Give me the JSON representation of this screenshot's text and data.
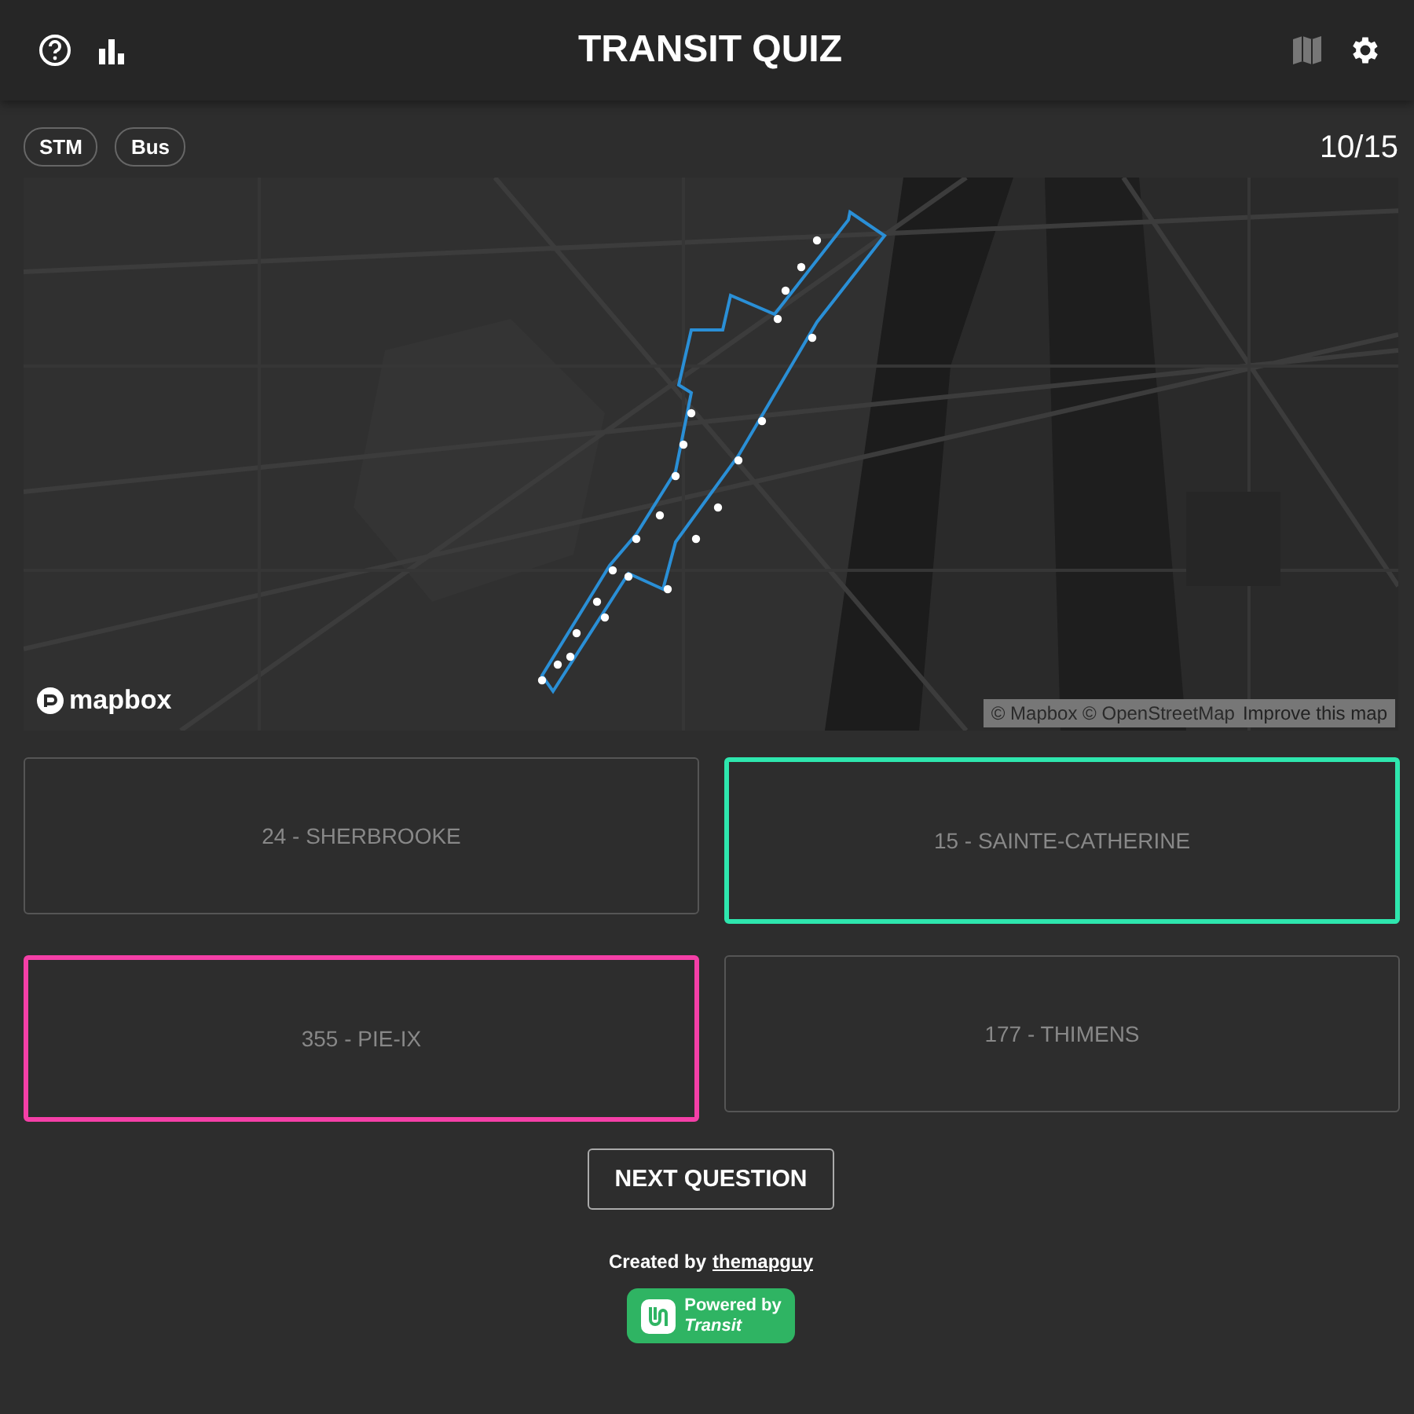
{
  "header": {
    "title": "TRANSIT QUIZ"
  },
  "tags": [
    "STM",
    "Bus"
  ],
  "progress": "10/15",
  "map": {
    "kind": "picture",
    "logo": "mapbox",
    "attribution": "© Mapbox © OpenStreetMap",
    "improve_link": "Improve this map"
  },
  "answers": [
    {
      "label": "24 - SHERBROOKE",
      "selected": false,
      "correct": false
    },
    {
      "label": "15 - SAINTE-CATHERINE",
      "selected": false,
      "correct": true
    },
    {
      "label": "355 - PIE-IX",
      "selected": true,
      "correct": false
    },
    {
      "label": "177 - THIMENS",
      "selected": false,
      "correct": false
    }
  ],
  "next_button": "NEXT QUESTION",
  "footer": {
    "credit": "Created by",
    "author": "themapguy",
    "badge_line_1": "Powered by",
    "badge_line_2": "Transit"
  }
}
